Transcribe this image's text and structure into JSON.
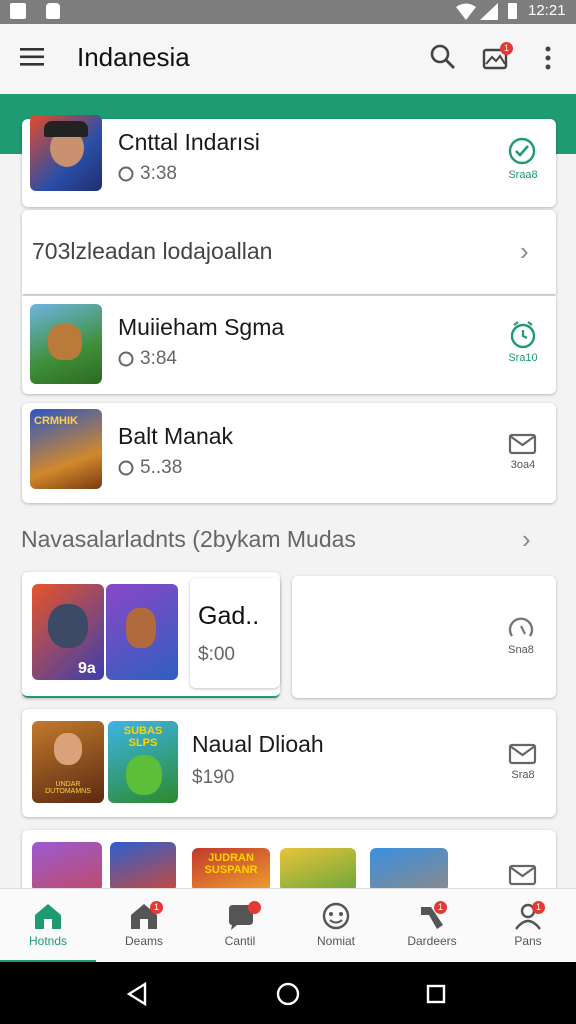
{
  "status": {
    "time": "12:21"
  },
  "appbar": {
    "title": "Indanesia",
    "notif_count": "1"
  },
  "cards": [
    {
      "title": "Cnttal Indarısi",
      "meta": "3:38",
      "action_label": "Sraa8"
    },
    {
      "title": "Muiieham Sgma",
      "meta": "3:84",
      "action_label": "Sra10"
    },
    {
      "title": "Balt Manak",
      "meta": "5..38",
      "action_label": "3oa4"
    }
  ],
  "promo_row": {
    "text": "703lzleadan lodajoallan"
  },
  "thumb_texts": {
    "t3": "CRMHIK",
    "g1": "9a",
    "n2": "SUBAS SLPS",
    "n1": "UNDAR DUTOMAMNS",
    "b3": "JUDRAN SUSPANR"
  },
  "section": {
    "title": "Navasalarladnts (2bykam Mudas"
  },
  "featured": {
    "title": "Gad..",
    "price": "$:00",
    "side_label": "Sna8"
  },
  "card2": {
    "title": "Naual Dlioah",
    "price": "$190",
    "side_label": "Sra8"
  },
  "nav": [
    {
      "label": "Hotnds",
      "active": true
    },
    {
      "label": "Deams",
      "badge": "1"
    },
    {
      "label": "Cantil",
      "badge": ""
    },
    {
      "label": "Nomiat"
    },
    {
      "label": "Dardeers",
      "badge": "1"
    },
    {
      "label": "Pans",
      "badge": "1"
    }
  ]
}
